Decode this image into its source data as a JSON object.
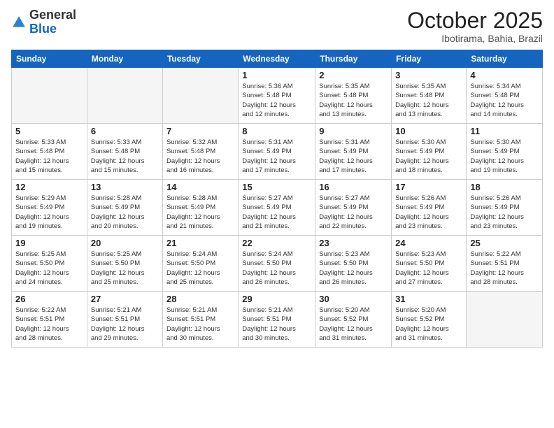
{
  "logo": {
    "general": "General",
    "blue": "Blue"
  },
  "header": {
    "month": "October 2025",
    "location": "Ibotirama, Bahia, Brazil"
  },
  "weekdays": [
    "Sunday",
    "Monday",
    "Tuesday",
    "Wednesday",
    "Thursday",
    "Friday",
    "Saturday"
  ],
  "weeks": [
    [
      {
        "day": "",
        "info": ""
      },
      {
        "day": "",
        "info": ""
      },
      {
        "day": "",
        "info": ""
      },
      {
        "day": "1",
        "info": "Sunrise: 5:36 AM\nSunset: 5:48 PM\nDaylight: 12 hours\nand 12 minutes."
      },
      {
        "day": "2",
        "info": "Sunrise: 5:35 AM\nSunset: 5:48 PM\nDaylight: 12 hours\nand 13 minutes."
      },
      {
        "day": "3",
        "info": "Sunrise: 5:35 AM\nSunset: 5:48 PM\nDaylight: 12 hours\nand 13 minutes."
      },
      {
        "day": "4",
        "info": "Sunrise: 5:34 AM\nSunset: 5:48 PM\nDaylight: 12 hours\nand 14 minutes."
      }
    ],
    [
      {
        "day": "5",
        "info": "Sunrise: 5:33 AM\nSunset: 5:48 PM\nDaylight: 12 hours\nand 15 minutes."
      },
      {
        "day": "6",
        "info": "Sunrise: 5:33 AM\nSunset: 5:48 PM\nDaylight: 12 hours\nand 15 minutes."
      },
      {
        "day": "7",
        "info": "Sunrise: 5:32 AM\nSunset: 5:48 PM\nDaylight: 12 hours\nand 16 minutes."
      },
      {
        "day": "8",
        "info": "Sunrise: 5:31 AM\nSunset: 5:49 PM\nDaylight: 12 hours\nand 17 minutes."
      },
      {
        "day": "9",
        "info": "Sunrise: 5:31 AM\nSunset: 5:49 PM\nDaylight: 12 hours\nand 17 minutes."
      },
      {
        "day": "10",
        "info": "Sunrise: 5:30 AM\nSunset: 5:49 PM\nDaylight: 12 hours\nand 18 minutes."
      },
      {
        "day": "11",
        "info": "Sunrise: 5:30 AM\nSunset: 5:49 PM\nDaylight: 12 hours\nand 19 minutes."
      }
    ],
    [
      {
        "day": "12",
        "info": "Sunrise: 5:29 AM\nSunset: 5:49 PM\nDaylight: 12 hours\nand 19 minutes."
      },
      {
        "day": "13",
        "info": "Sunrise: 5:28 AM\nSunset: 5:49 PM\nDaylight: 12 hours\nand 20 minutes."
      },
      {
        "day": "14",
        "info": "Sunrise: 5:28 AM\nSunset: 5:49 PM\nDaylight: 12 hours\nand 21 minutes."
      },
      {
        "day": "15",
        "info": "Sunrise: 5:27 AM\nSunset: 5:49 PM\nDaylight: 12 hours\nand 21 minutes."
      },
      {
        "day": "16",
        "info": "Sunrise: 5:27 AM\nSunset: 5:49 PM\nDaylight: 12 hours\nand 22 minutes."
      },
      {
        "day": "17",
        "info": "Sunrise: 5:26 AM\nSunset: 5:49 PM\nDaylight: 12 hours\nand 23 minutes."
      },
      {
        "day": "18",
        "info": "Sunrise: 5:26 AM\nSunset: 5:49 PM\nDaylight: 12 hours\nand 23 minutes."
      }
    ],
    [
      {
        "day": "19",
        "info": "Sunrise: 5:25 AM\nSunset: 5:50 PM\nDaylight: 12 hours\nand 24 minutes."
      },
      {
        "day": "20",
        "info": "Sunrise: 5:25 AM\nSunset: 5:50 PM\nDaylight: 12 hours\nand 25 minutes."
      },
      {
        "day": "21",
        "info": "Sunrise: 5:24 AM\nSunset: 5:50 PM\nDaylight: 12 hours\nand 25 minutes."
      },
      {
        "day": "22",
        "info": "Sunrise: 5:24 AM\nSunset: 5:50 PM\nDaylight: 12 hours\nand 26 minutes."
      },
      {
        "day": "23",
        "info": "Sunrise: 5:23 AM\nSunset: 5:50 PM\nDaylight: 12 hours\nand 26 minutes."
      },
      {
        "day": "24",
        "info": "Sunrise: 5:23 AM\nSunset: 5:50 PM\nDaylight: 12 hours\nand 27 minutes."
      },
      {
        "day": "25",
        "info": "Sunrise: 5:22 AM\nSunset: 5:51 PM\nDaylight: 12 hours\nand 28 minutes."
      }
    ],
    [
      {
        "day": "26",
        "info": "Sunrise: 5:22 AM\nSunset: 5:51 PM\nDaylight: 12 hours\nand 28 minutes."
      },
      {
        "day": "27",
        "info": "Sunrise: 5:21 AM\nSunset: 5:51 PM\nDaylight: 12 hours\nand 29 minutes."
      },
      {
        "day": "28",
        "info": "Sunrise: 5:21 AM\nSunset: 5:51 PM\nDaylight: 12 hours\nand 30 minutes."
      },
      {
        "day": "29",
        "info": "Sunrise: 5:21 AM\nSunset: 5:51 PM\nDaylight: 12 hours\nand 30 minutes."
      },
      {
        "day": "30",
        "info": "Sunrise: 5:20 AM\nSunset: 5:52 PM\nDaylight: 12 hours\nand 31 minutes."
      },
      {
        "day": "31",
        "info": "Sunrise: 5:20 AM\nSunset: 5:52 PM\nDaylight: 12 hours\nand 31 minutes."
      },
      {
        "day": "",
        "info": ""
      }
    ]
  ]
}
